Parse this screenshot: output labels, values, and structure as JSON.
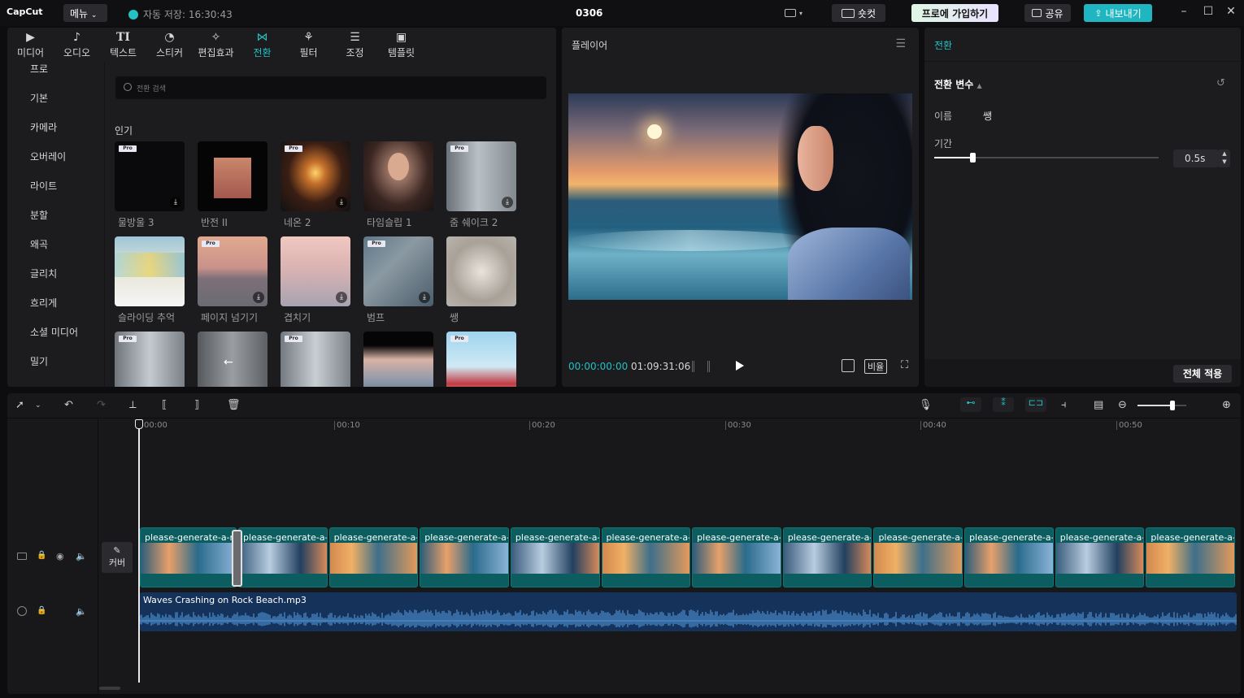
{
  "titlebar": {
    "logo": "CapCut",
    "menu": "메뉴",
    "autosave": "자동 저장: 16:30:43",
    "project": "0306",
    "shortcut": "숏컷",
    "pro_join": "프로에 가입하기",
    "share": "공유",
    "export": "내보내기"
  },
  "media": {
    "tabs": [
      {
        "label": "미디어",
        "icon": "media-icon"
      },
      {
        "label": "오디오",
        "icon": "audio-icon"
      },
      {
        "label": "텍스트",
        "icon": "text-icon"
      },
      {
        "label": "스티커",
        "icon": "sticker-icon"
      },
      {
        "label": "편집효과",
        "icon": "effects-icon"
      },
      {
        "label": "전환",
        "icon": "transition-icon"
      },
      {
        "label": "필터",
        "icon": "filter-icon"
      },
      {
        "label": "조정",
        "icon": "adjust-icon"
      },
      {
        "label": "템플릿",
        "icon": "template-icon"
      }
    ],
    "categories": [
      "프로",
      "기본",
      "카메라",
      "오버레이",
      "라이트",
      "분할",
      "왜곡",
      "글리치",
      "흐리게",
      "소셜 미디어",
      "밀기"
    ],
    "search_placeholder": "전환 검색",
    "section": "인기",
    "items": [
      {
        "label": "물방울 3",
        "pro": "Pro"
      },
      {
        "label": "반전 II",
        "pro": ""
      },
      {
        "label": "네온 2",
        "pro": "Pro"
      },
      {
        "label": "타임슬립 1",
        "pro": ""
      },
      {
        "label": "줌 쉐이크 2",
        "pro": "Pro"
      },
      {
        "label": "슬라이딩 추억",
        "pro": ""
      },
      {
        "label": "페이지 넘기기",
        "pro": "Pro"
      },
      {
        "label": "겹치기",
        "pro": ""
      },
      {
        "label": "범프",
        "pro": "Pro"
      },
      {
        "label": "쌩",
        "pro": ""
      },
      {
        "label": "",
        "pro": "Pro"
      },
      {
        "label": "",
        "pro": ""
      },
      {
        "label": "",
        "pro": "Pro"
      },
      {
        "label": "",
        "pro": ""
      },
      {
        "label": "",
        "pro": "Pro"
      }
    ]
  },
  "player": {
    "title": "플레이어",
    "current_time": "00:00:00:00",
    "total_time": "01:09:31:06",
    "ratio": "비율"
  },
  "props": {
    "title": "전환",
    "section": "전환 변수",
    "name_label": "이름",
    "name_value": "쌩",
    "duration_label": "기간",
    "duration_value": "0.5s",
    "duration_fraction": 0.17,
    "apply_all": "전체 적용"
  },
  "timeline": {
    "ruler": [
      "00:00",
      "00:10",
      "00:20",
      "00:30",
      "00:40",
      "00:50"
    ],
    "cover_label": "커버",
    "clip_name": "please-generate-a-rea",
    "clip_count": 12,
    "audio_name": "Waves Crashing on Rock Beach.mp3",
    "zoom_fraction": 0.72
  },
  "colors": {
    "accent": "#22c1c3",
    "clip": "#0b5d5f",
    "audio": "#14325a"
  }
}
